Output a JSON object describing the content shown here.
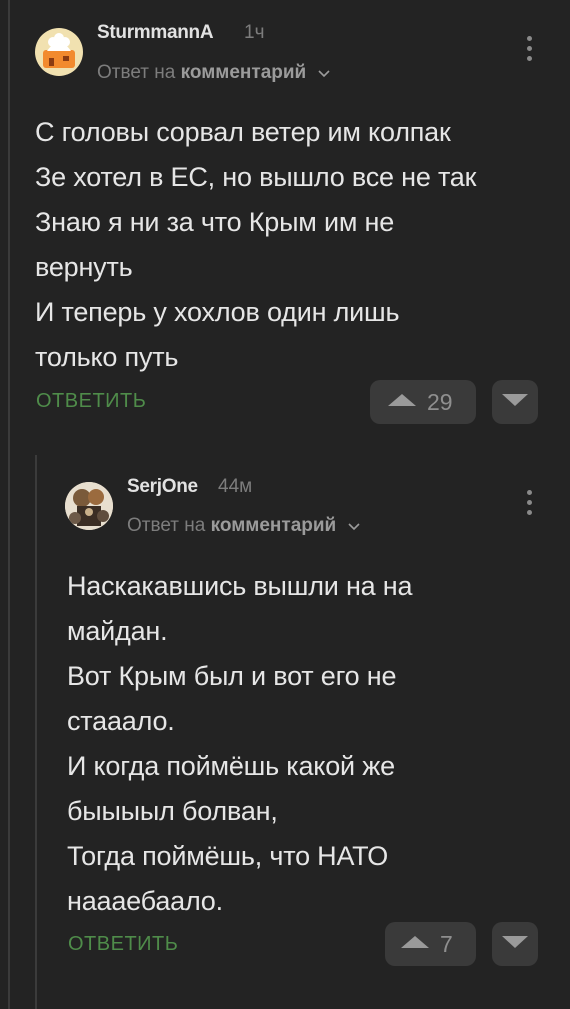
{
  "comments": [
    {
      "username": "SturmmannA",
      "time": "1ч",
      "reply_prefix": "Ответ на",
      "reply_target": "комментарий",
      "text": "С головы сорвал ветер им колпак\nЗе хотел в ЕС, но вышло все не так\nЗнаю я ни за что Крым им не\nвернуть\nИ теперь у хохлов один лишь\nтолько путь",
      "reply_label": "ОТВЕТИТЬ",
      "votes": "29"
    },
    {
      "username": "SerjOne",
      "time": "44м",
      "reply_prefix": "Ответ на",
      "reply_target": "комментарий",
      "text": "Наскакавшись вышли на на\nмайдан.\nВот Крым был и вот его не\nстааало.\nИ когда поймёшь какой же\nбыыыыл болван,\nТогда поймёшь, что НАТО\nнаааебаало.",
      "reply_label": "ОТВЕТИТЬ",
      "votes": "7"
    }
  ],
  "colors": {
    "background": "#232323",
    "reply_button": "#4f8c4a",
    "vote_button_bg": "#3a3a3a"
  },
  "icons": [
    "avatar",
    "chevron-down-icon",
    "more-vertical-icon",
    "arrow-up-icon",
    "arrow-down-icon"
  ]
}
